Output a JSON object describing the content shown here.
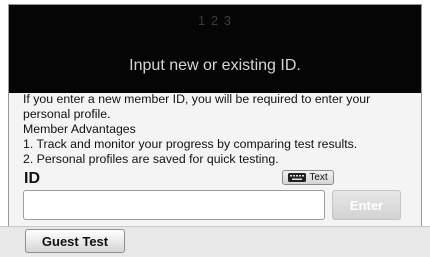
{
  "header": {
    "steps": "1 2 3",
    "title": "Input new or existing ID."
  },
  "info": {
    "line1": "If you enter a new member ID, you will be required to enter your personal profile.",
    "line2": "Member Advantages",
    "line3": "1. Track and monitor your progress by comparing test results.",
    "line4": "2. Personal profiles are saved for quick testing."
  },
  "id_field": {
    "label": "ID",
    "value": "",
    "placeholder": ""
  },
  "buttons": {
    "text_label": "Text",
    "text_icon": "keyboard-icon",
    "enter_label": "Enter",
    "guest_label": "Guest Test"
  },
  "colors": {
    "header_bg": "#050505",
    "title_text": "#d6d6d6",
    "enter_disabled_text": "#ffffff"
  }
}
